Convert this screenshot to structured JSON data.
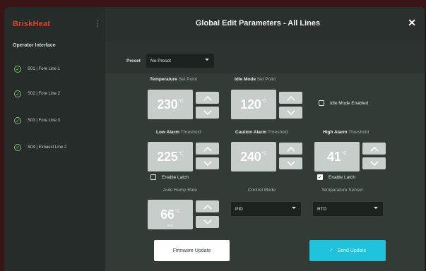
{
  "sidebar": {
    "brand": "BriskHeat",
    "menu_icon": "kebab-icon",
    "section_title": "Operator Interface",
    "items": [
      {
        "label": "S01 | Fore Line 1"
      },
      {
        "label": "S02 | Fore Line 2"
      },
      {
        "label": "S03 | Fore Line 3"
      },
      {
        "label": "S04 | Exhaust Line 2"
      }
    ]
  },
  "dialog": {
    "title": "Global Edit Parameters - All Lines",
    "close_icon": "close-icon"
  },
  "preset": {
    "label": "Preset",
    "value": "No Preset"
  },
  "fields": {
    "temp_setpoint": {
      "label_bold": "Temperature",
      "label_rest": " Set Point",
      "value": "230",
      "unit": "°C"
    },
    "idle_setpoint": {
      "label_bold": "Idle Mode",
      "label_rest": " Set Point",
      "value": "120",
      "unit": "°C"
    },
    "low_alarm": {
      "label_bold": "Low Alarm",
      "label_rest": " Threshold",
      "value": "225",
      "unit": "°C"
    },
    "caution_alarm": {
      "label_bold": "Caution Alarm",
      "label_rest": " Threshold",
      "value": "240",
      "unit": "°C"
    },
    "high_alarm": {
      "label_bold": "High Alarm",
      "label_rest": " Threshold",
      "value": "41",
      "unit": "°C"
    },
    "auto_ramp": {
      "label": "Auto Ramp Rate",
      "value": "66",
      "unit": "°C",
      "sub": "/min"
    }
  },
  "checkboxes": {
    "idle_mode": {
      "label": "Idle Mode Enabled",
      "checked": false
    },
    "enable_latch_low": {
      "label": "Enable Latch",
      "checked": false
    },
    "enable_latch_high": {
      "label": "Enable Latch",
      "checked": true
    }
  },
  "control_mode": {
    "label": "Control Mode",
    "value": "PID"
  },
  "temp_sensor": {
    "label": "Temperature Sensor",
    "value": "RTD"
  },
  "buttons": {
    "firmware": "Firmware Update",
    "send": "Send Update"
  },
  "colors": {
    "brand": "#e0402c",
    "check_green": "#7cc45e",
    "send_button": "#1fc4dc"
  }
}
